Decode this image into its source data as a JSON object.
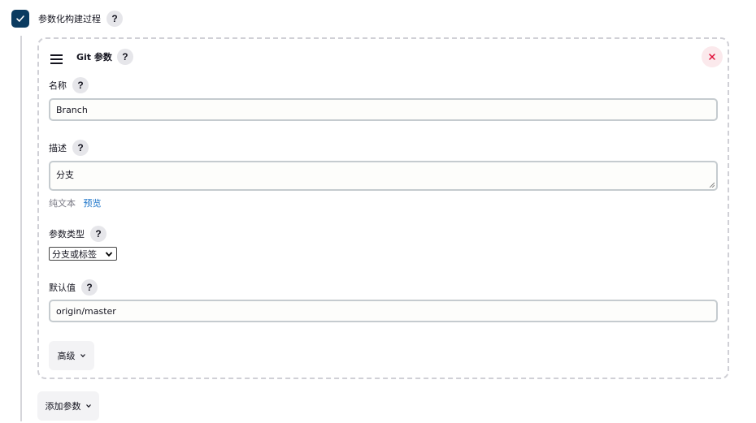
{
  "parameterized": {
    "label": "参数化构建过程",
    "checked": true,
    "help": "?"
  },
  "git_param": {
    "title": "Git 参数",
    "help": "?",
    "close_symbol": "×",
    "name_field": {
      "label": "名称",
      "help": "?",
      "value": "Branch"
    },
    "description_field": {
      "label": "描述",
      "help": "?",
      "value": "分支",
      "plain_text": "纯文本",
      "preview": "预览"
    },
    "type_field": {
      "label": "参数类型",
      "help": "?",
      "selected": "分支或标签"
    },
    "default_field": {
      "label": "默认值",
      "help": "?",
      "value": "origin/master"
    },
    "advanced_label": "高级"
  },
  "add_param_label": "添加参数",
  "icons": {
    "checkbox": "check-icon",
    "drag": "drag-handle-icon",
    "close": "close-icon",
    "chevron": "chevron-down-icon"
  },
  "colors": {
    "checkbox_bg": "#0b3b60",
    "close_color": "#e0103a",
    "link_color": "#1a73c9"
  }
}
